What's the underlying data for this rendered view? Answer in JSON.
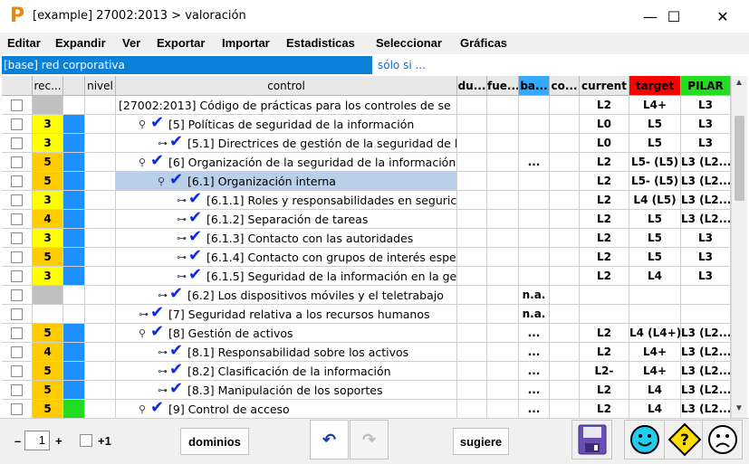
{
  "window": {
    "title": "[example] 27002:2013 > valoración",
    "logo": "P",
    "minimize_glyph": "—",
    "maximize_glyph": "☐",
    "close_glyph": "✕"
  },
  "menu": [
    "Editar",
    "Expandir",
    "Ver",
    "Exportar",
    "Importar",
    "Estadisticas",
    "Seleccionar",
    "Gráficas"
  ],
  "filter": {
    "base": "[base] red corporativa",
    "solo_si": "sólo si ..."
  },
  "columns": [
    {
      "label": "",
      "key": "check"
    },
    {
      "label": "rec...",
      "key": "rec"
    },
    {
      "label": "",
      "key": "color"
    },
    {
      "label": "nivel",
      "key": "nivel"
    },
    {
      "label": "control",
      "key": "control"
    },
    {
      "label": "du...",
      "key": "du"
    },
    {
      "label": "fue...",
      "key": "fue"
    },
    {
      "label": "ba...",
      "key": "ba"
    },
    {
      "label": "co...",
      "key": "co"
    },
    {
      "label": "current",
      "key": "current"
    },
    {
      "label": "target",
      "key": "target"
    },
    {
      "label": "PILAR",
      "key": "pilar"
    }
  ],
  "colors": {
    "rec_yellow": "#ffff00",
    "rec_orange": "#ffcc00",
    "rec_gray": "#c0c0c0",
    "color_blue": "#1e90ff",
    "color_green": "#22dd22",
    "target_header": "#ff0000",
    "pilar_header": "#22dd22",
    "ba_header": "#33aaff",
    "selected_row": "#b8d0ea"
  },
  "rows": [
    {
      "rec": "",
      "recColor": "gray",
      "colColor": "",
      "depth": 0,
      "tree": "",
      "tick": false,
      "text": "[27002:2013] Código de prácticas para los controles de se",
      "ba": "",
      "current": "L2",
      "target": "L4+",
      "pilar": "L3"
    },
    {
      "rec": "3",
      "recColor": "yellow",
      "colColor": "blue",
      "depth": 1,
      "tree": "⚲",
      "tick": true,
      "text": "[5] Políticas de seguridad de la información",
      "ba": "",
      "current": "L0",
      "target": "L5",
      "pilar": "L3"
    },
    {
      "rec": "3",
      "recColor": "yellow",
      "colColor": "blue",
      "depth": 2,
      "tree": "⊶",
      "tick": true,
      "text": "[5.1] Directrices de gestión de la seguridad de la",
      "ba": "",
      "current": "L0",
      "target": "L5",
      "pilar": "L3"
    },
    {
      "rec": "5",
      "recColor": "orange",
      "colColor": "blue",
      "depth": 1,
      "tree": "⚲",
      "tick": true,
      "text": "[6] Organización de la seguridad de la información",
      "ba": "...",
      "current": "L2",
      "target": "L5- (L5)",
      "pilar": "L3 (L2..."
    },
    {
      "rec": "5",
      "recColor": "orange",
      "colColor": "blue",
      "depth": 2,
      "tree": "⚲",
      "tick": true,
      "text": "[6.1] Organización interna",
      "ba": "",
      "current": "L2",
      "target": "L5- (L5)",
      "pilar": "L3 (L2...",
      "selected": true
    },
    {
      "rec": "3",
      "recColor": "yellow",
      "colColor": "blue",
      "depth": 3,
      "tree": "⊶",
      "tick": true,
      "text": "[6.1.1] Roles y responsabilidades en seguric",
      "ba": "",
      "current": "L2",
      "target": "L4 (L5)",
      "pilar": "L3 (L2..."
    },
    {
      "rec": "4",
      "recColor": "orange",
      "colColor": "blue",
      "depth": 3,
      "tree": "⊶",
      "tick": true,
      "text": "[6.1.2] Separación de tareas",
      "ba": "",
      "current": "L2",
      "target": "L5",
      "pilar": "L3 (L2..."
    },
    {
      "rec": "3",
      "recColor": "yellow",
      "colColor": "blue",
      "depth": 3,
      "tree": "⊶",
      "tick": true,
      "text": "[6.1.3] Contacto con las autoridades",
      "ba": "",
      "current": "L2",
      "target": "L5",
      "pilar": "L3"
    },
    {
      "rec": "5",
      "recColor": "orange",
      "colColor": "blue",
      "depth": 3,
      "tree": "⊶",
      "tick": true,
      "text": "[6.1.4] Contacto con grupos de interés espec",
      "ba": "",
      "current": "L2",
      "target": "L5",
      "pilar": "L3"
    },
    {
      "rec": "3",
      "recColor": "yellow",
      "colColor": "blue",
      "depth": 3,
      "tree": "⊶",
      "tick": true,
      "text": "[6.1.5] Seguridad de la información en la ges",
      "ba": "",
      "current": "L2",
      "target": "L4",
      "pilar": "L3"
    },
    {
      "rec": "",
      "recColor": "gray",
      "colColor": "",
      "depth": 2,
      "tree": "⊶",
      "tick": true,
      "text": "[6.2] Los dispositivos móviles y el teletrabajo",
      "ba": "n.a.",
      "current": "",
      "target": "",
      "pilar": ""
    },
    {
      "rec": "",
      "recColor": "",
      "colColor": "",
      "depth": 1,
      "tree": "⊶",
      "tick": true,
      "text": "[7] Seguridad relativa a los recursos humanos",
      "ba": "n.a.",
      "current": "",
      "target": "",
      "pilar": ""
    },
    {
      "rec": "5",
      "recColor": "orange",
      "colColor": "blue",
      "depth": 1,
      "tree": "⚲",
      "tick": true,
      "text": "[8] Gestión de activos",
      "ba": "...",
      "current": "L2",
      "target": "L4 (L4+)",
      "pilar": "L3 (L2..."
    },
    {
      "rec": "4",
      "recColor": "orange",
      "colColor": "blue",
      "depth": 2,
      "tree": "⊶",
      "tick": true,
      "text": "[8.1] Responsabilidad sobre los activos",
      "ba": "...",
      "current": "L2",
      "target": "L4+",
      "pilar": "L3 (L2..."
    },
    {
      "rec": "5",
      "recColor": "orange",
      "colColor": "blue",
      "depth": 2,
      "tree": "⊶",
      "tick": true,
      "text": "[8.2] Clasificación de la información",
      "ba": "...",
      "current": "L2-",
      "target": "L4+",
      "pilar": "L3 (L2..."
    },
    {
      "rec": "5",
      "recColor": "orange",
      "colColor": "blue",
      "depth": 2,
      "tree": "⊶",
      "tick": true,
      "text": "[8.3] Manipulación de los soportes",
      "ba": "...",
      "current": "L2",
      "target": "L4",
      "pilar": "L3 (L2..."
    },
    {
      "rec": "5",
      "recColor": "orange",
      "colColor": "green",
      "depth": 1,
      "tree": "⚲",
      "tick": true,
      "text": "[9] Control de acceso",
      "ba": "...",
      "current": "L2",
      "target": "L4",
      "pilar": "L3 (L2..."
    }
  ],
  "bottom": {
    "minus": "–",
    "level_value": "1",
    "plus": "+",
    "plus1_label": "+1",
    "dominios": "dominios",
    "undo_glyph": "↶",
    "redo_glyph": "↷",
    "sugiere": "sugiere",
    "save_glyph": "💾",
    "smile_glyph": "☺",
    "question_glyph": "?",
    "sad_glyph": "☹"
  }
}
